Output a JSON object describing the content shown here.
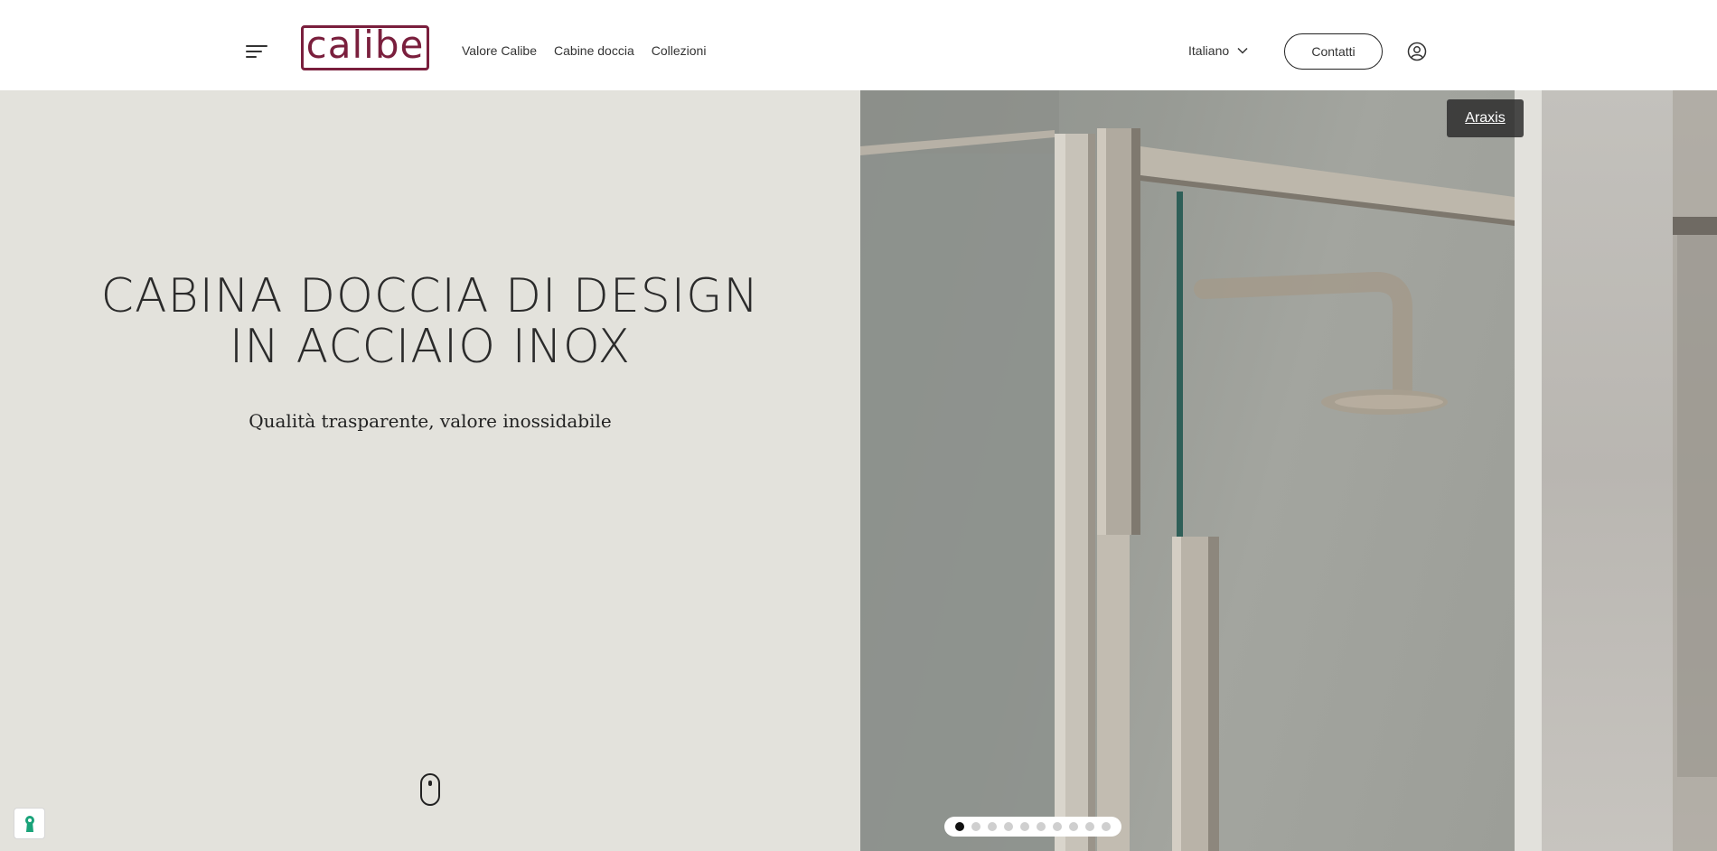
{
  "header": {
    "logo_text": "calibe",
    "brand_color": "#7a1f3d",
    "menu_icon": "hamburger-icon",
    "nav": [
      {
        "label": "Valore Calibe"
      },
      {
        "label": "Cabine doccia"
      },
      {
        "label": "Collezioni"
      }
    ],
    "language": "Italiano",
    "language_icon": "chevron-down-icon",
    "contact_label": "Contatti",
    "user_icon": "user-icon"
  },
  "hero": {
    "title_line1": "CABINA DOCCIA DI DESIGN",
    "title_line2": "IN ACCIAIO INOX",
    "subtitle": "Qualità trasparente, valore inossidabile",
    "background_color": "#e3e2dc",
    "scroll_icon": "mouse-scroll-icon"
  },
  "slider": {
    "caption": "Araxis",
    "slide_count": 10,
    "active_index": 0
  },
  "cookie": {
    "icon": "keyhole-icon",
    "color": "#1aa37a"
  }
}
